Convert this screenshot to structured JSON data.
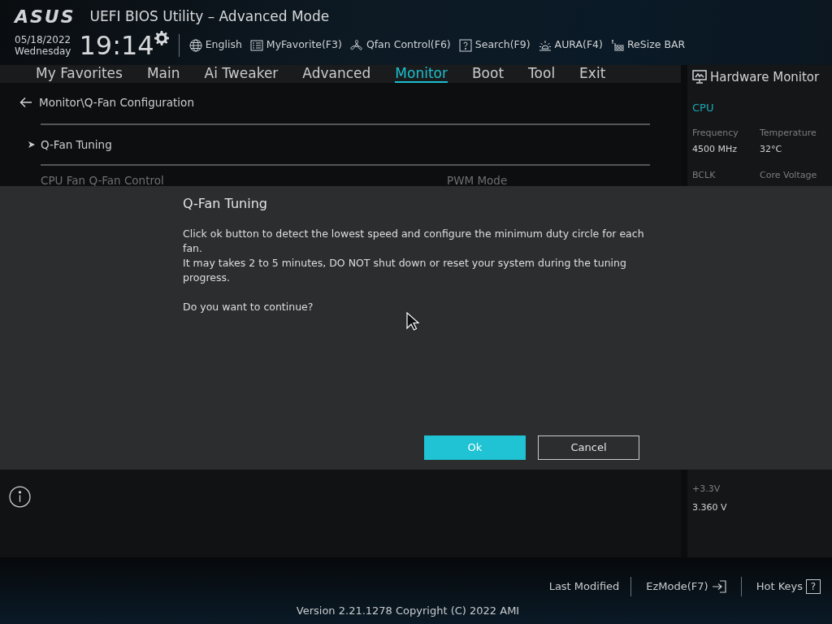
{
  "header": {
    "logo": "ASUS",
    "title": "UEFI BIOS Utility – Advanced Mode",
    "date": "05/18/2022",
    "day": "Wednesday",
    "time": "19:14",
    "tools": [
      {
        "kind": "globe",
        "label": "English"
      },
      {
        "kind": "list",
        "label": "MyFavorite(F3)"
      },
      {
        "kind": "fan",
        "label": "Qfan Control(F6)"
      },
      {
        "kind": "search",
        "label": "Search(F9)"
      },
      {
        "kind": "aura",
        "label": "AURA(F4)"
      },
      {
        "kind": "resize",
        "label": "ReSize BAR"
      }
    ]
  },
  "tabs": [
    {
      "label": "My Favorites",
      "selected": false
    },
    {
      "label": "Main",
      "selected": false
    },
    {
      "label": "Ai Tweaker",
      "selected": false
    },
    {
      "label": "Advanced",
      "selected": false
    },
    {
      "label": "Monitor",
      "selected": true
    },
    {
      "label": "Boot",
      "selected": false
    },
    {
      "label": "Tool",
      "selected": false
    },
    {
      "label": "Exit",
      "selected": false
    }
  ],
  "breadcrumb": "Monitor\\Q-Fan Configuration",
  "items": [
    {
      "kind": "submenu",
      "label": "Q-Fan Tuning"
    },
    {
      "kind": "setting",
      "label": "CPU Fan Q-Fan Control",
      "value": "PWM Mode"
    }
  ],
  "hardware_monitor": {
    "title": "Hardware Monitor",
    "section": "CPU",
    "readings": [
      {
        "label": "Frequency",
        "value": "4500 MHz"
      },
      {
        "label": "Temperature",
        "value": "32°C"
      }
    ],
    "cut_labels": [
      "BCLK",
      "Core Voltage"
    ],
    "lower_readings": [
      {
        "label": "+3.3V",
        "value": "3.360 V"
      }
    ]
  },
  "dialog": {
    "title": "Q-Fan Tuning",
    "paragraphs": [
      "Click ok button to detect the lowest speed and configure the minimum duty circle for each fan.\nIt may takes 2 to 5 minutes, DO NOT shut down or reset your system during the tuning progress.",
      "Do you want to continue?"
    ],
    "buttons": [
      {
        "label": "Ok",
        "selected": true
      },
      {
        "label": "Cancel",
        "selected": false
      }
    ]
  },
  "footer": {
    "last_modified": "Last Modified",
    "ez_mode": "EzMode(F7)",
    "hot_keys": "Hot Keys",
    "hot_keys_key": "?",
    "version": "Version 2.21.1278 Copyright (C) 2022 AMI"
  }
}
